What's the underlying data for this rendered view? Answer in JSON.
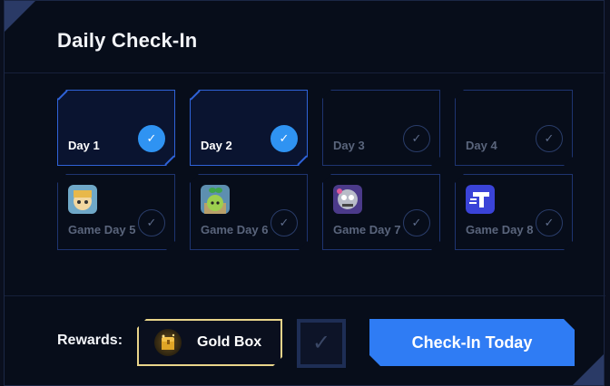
{
  "title": "Daily Check-In",
  "days": [
    {
      "label": "Day 1",
      "checked": true
    },
    {
      "label": "Day 2",
      "checked": true
    },
    {
      "label": "Day 3",
      "checked": false
    },
    {
      "label": "Day 4",
      "checked": false
    }
  ],
  "game_days": [
    {
      "label": "Game Day 5",
      "icon": "game-icon-girl"
    },
    {
      "label": "Game Day 6",
      "icon": "game-icon-sprout"
    },
    {
      "label": "Game Day 7",
      "icon": "game-icon-robot"
    },
    {
      "label": "Game Day 8",
      "icon": "game-icon-t-logo"
    }
  ],
  "rewards": {
    "label": "Rewards:",
    "gold_box_label": "Gold Box"
  },
  "checkin_button": "Check-In Today",
  "check_glyph": "✓",
  "colors": {
    "accent": "#2f7cf4",
    "checked": "#2f93f2",
    "gold": "#e8d48a",
    "background": "#070d1a"
  }
}
